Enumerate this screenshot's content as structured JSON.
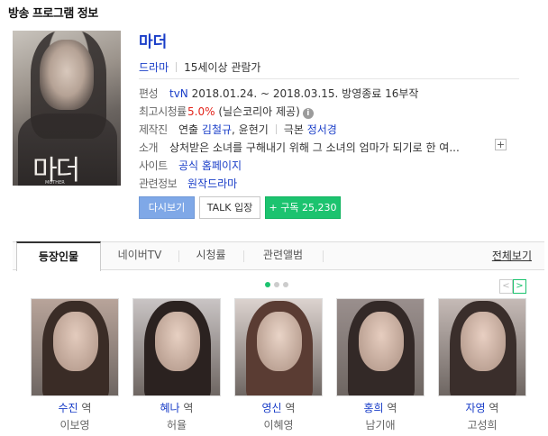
{
  "header": {
    "title": "방송 프로그램 정보"
  },
  "poster": {
    "title_text": "마더",
    "sub_text": "MOTHER",
    "alt": "drama-poster"
  },
  "program": {
    "title": "마더",
    "genre": "드라마",
    "rating": "15세이상 관람가",
    "info": [
      {
        "key": "편성",
        "parts": [
          {
            "t": "tvN",
            "c": "lnk"
          },
          {
            "t": " 2018.01.24. ~ 2018.03.15. 방영종료 16부작",
            "c": ""
          }
        ]
      },
      {
        "key": "최고시청률",
        "parts": [
          {
            "t": "5.0%",
            "c": "red"
          },
          {
            "t": " (닐슨코리아 제공)",
            "c": ""
          }
        ]
      },
      {
        "key": "제작진",
        "parts": [
          {
            "t": "연출 ",
            "c": ""
          },
          {
            "t": "김철규",
            "c": "lnk"
          },
          {
            "t": ", 윤현기",
            "c": ""
          },
          {
            "t": "|",
            "c": "bar"
          },
          {
            "t": "극본 ",
            "c": ""
          },
          {
            "t": "정서경",
            "c": "lnk"
          }
        ]
      },
      {
        "key": "소개",
        "parts": [
          {
            "t": "상처받은 소녀를 구해내기 위해 그 소녀의 엄마가 되기로 한 여...",
            "c": ""
          }
        ]
      },
      {
        "key": "사이트",
        "parts": [
          {
            "t": "공식 홈페이지",
            "c": "lnk"
          }
        ]
      },
      {
        "key": "관련정보",
        "parts": [
          {
            "t": "원작드라마",
            "c": "lnk"
          }
        ]
      }
    ],
    "info_icon": "i",
    "more_icon": "+"
  },
  "buttons": {
    "replay": "다시보기",
    "talk": "TALK 입장",
    "subscribe": "+ 구독 25,230"
  },
  "tabs": [
    {
      "label": "등장인물",
      "active": true
    },
    {
      "label": "네이버TV",
      "active": false
    },
    {
      "label": "시청률",
      "active": false
    },
    {
      "label": "관련앨범",
      "active": false
    }
  ],
  "all_view": "전체보기",
  "pager": {
    "prev": "<",
    "next": ">"
  },
  "carousel": {
    "total_dots": 3,
    "active_index": 0
  },
  "cast": [
    {
      "role": "수진",
      "suffix": " 역",
      "actor": "이보영"
    },
    {
      "role": "혜나",
      "suffix": " 역",
      "actor": "허율"
    },
    {
      "role": "영신",
      "suffix": " 역",
      "actor": "이혜영"
    },
    {
      "role": "홍희",
      "suffix": " 역",
      "actor": "남기애"
    },
    {
      "role": "자영",
      "suffix": " 역",
      "actor": "고성희"
    }
  ],
  "colors": {
    "link": "#1a3ec8",
    "accent_green": "#1cc36f",
    "rating_red": "#e2231a",
    "replay_blue": "#7fa8e7"
  }
}
